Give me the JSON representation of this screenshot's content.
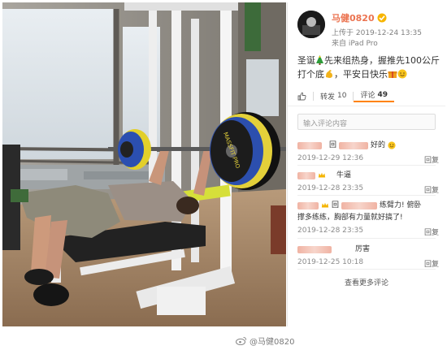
{
  "post": {
    "username": "马健0820",
    "uploaded": "上传于 2019-12-24 13:35",
    "source": "来自 iPad Pro",
    "text_a": "圣诞",
    "text_b": "先来组热身，握推先100公斤打个底",
    "text_c": "，平安日快乐",
    "actions": {
      "forward_label": "转发",
      "forward_count": "10",
      "comment_label": "评论",
      "comment_count": "49"
    }
  },
  "comment_input": {
    "placeholder": "输入评论内容"
  },
  "comments": [
    {
      "prefix": "回",
      "text": "好的",
      "time": "2019-12-29 12:36",
      "reply": "回复"
    },
    {
      "prefix": "",
      "text": "牛逼",
      "time": "2019-12-28 23:35",
      "reply": "回复"
    },
    {
      "prefix": "回",
      "text": "练臂力! 俯卧",
      "text2": "撑多练练，胸部有力量就好搞了!",
      "time": "2019-12-28 23:35",
      "reply": "回复"
    },
    {
      "prefix": "",
      "text": "厉害",
      "time": "2019-12-25 10:18",
      "reply": "回复"
    }
  ],
  "more_comments": "查看更多评论",
  "watermark": "@马健0820",
  "plate_text": "MASSFIT PRO",
  "colors": {
    "accent": "#ff8200",
    "username": "#eb7350",
    "plate_yellow": "#e8d21a",
    "plate_blue": "#2b4fb0"
  }
}
